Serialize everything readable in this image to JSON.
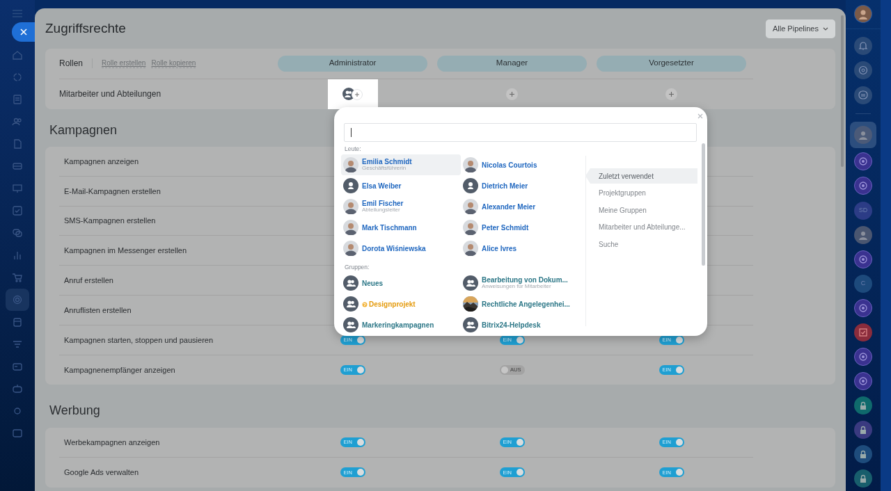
{
  "page": {
    "title": "Zugriffsrechte",
    "pipeline_filter": "Alle Pipelines"
  },
  "roles": {
    "label": "Rollen",
    "actions": [
      "Rolle erstellen",
      "Rolle kopieren"
    ],
    "columns": [
      {
        "name": "Administrator"
      },
      {
        "name": "Manager"
      },
      {
        "name": "Vorgesetzter"
      }
    ]
  },
  "members_row": {
    "label": "Mitarbeiter und Abteilungen",
    "cells": [
      {
        "selected": true
      },
      {
        "selected": false
      },
      {
        "selected": false
      }
    ]
  },
  "sections": [
    {
      "title": "Kampagnen",
      "rows": [
        {
          "label": "Kampagnen anzeigen"
        },
        {
          "label": "E-Mail-Kampagnen erstellen"
        },
        {
          "label": "SMS-Kampagnen erstellen"
        },
        {
          "label": "Kampagnen im Messenger erstellen"
        },
        {
          "label": "Anruf erstellen"
        },
        {
          "label": "Anruflisten erstellen"
        },
        {
          "label": "Kampagnen starten, stoppen und pausieren",
          "toggles": [
            {
              "on": true,
              "label": "EIN"
            },
            {
              "on": true,
              "label": "EIN"
            },
            {
              "on": true,
              "label": "EIN"
            }
          ]
        },
        {
          "label": "Kampagnenempfänger anzeigen",
          "toggles": [
            {
              "on": true,
              "label": "EIN"
            },
            {
              "on": false,
              "label": "AUS"
            },
            {
              "on": true,
              "label": "EIN"
            }
          ]
        }
      ]
    },
    {
      "title": "Werbung",
      "rows": [
        {
          "label": "Werbekampagnen anzeigen",
          "toggles": [
            {
              "on": true,
              "label": "EIN"
            },
            {
              "on": true,
              "label": "EIN"
            },
            {
              "on": true,
              "label": "EIN"
            }
          ]
        },
        {
          "label": "Google Ads verwalten",
          "toggles": [
            {
              "on": true,
              "label": "EIN"
            },
            {
              "on": true,
              "label": "EIN"
            },
            {
              "on": true,
              "label": "EIN"
            }
          ]
        }
      ]
    }
  ],
  "selector_popup": {
    "people_heading": "Leute:",
    "people": [
      {
        "name": "Emilia Schmidt",
        "subtitle": "Geschäftsführerin",
        "selected": true
      },
      {
        "name": "Nicolas Courtois",
        "selected": false
      },
      {
        "name": "Elsa Weiber",
        "kind": "default",
        "selected": false
      },
      {
        "name": "Dietrich Meier",
        "kind": "default",
        "selected": false
      },
      {
        "name": "Emil Fischer",
        "subtitle": "Abteilungsleiter",
        "selected": false
      },
      {
        "name": "Alexander Meier",
        "selected": false
      },
      {
        "name": "Mark Tischmann",
        "selected": false
      },
      {
        "name": "Peter Schmidt",
        "selected": false
      },
      {
        "name": "Dorota Wiśniewska",
        "selected": false
      },
      {
        "name": "Alice Ivres",
        "selected": false
      }
    ],
    "groups_heading": "Gruppen:",
    "groups": [
      {
        "name": "Neues",
        "kind": "group",
        "extranet": false
      },
      {
        "name": "Bearbeitung von Dokum...",
        "subtitle": "Anweisungen für Mitarbeiter",
        "kind": "group",
        "extranet": false
      },
      {
        "name": "Designprojekt",
        "kind": "group",
        "extranet": true
      },
      {
        "name": "Rechtliche Angelegenhei...",
        "kind": "picture",
        "extranet": false
      },
      {
        "name": "Markeringkampagnen",
        "kind": "group",
        "extranet": false
      },
      {
        "name": "Bitrix24-Helpdesk",
        "kind": "group",
        "extranet": false
      }
    ],
    "tabs": [
      {
        "label": "Zuletzt verwendet",
        "selected": true
      },
      {
        "label": "Projektgruppen",
        "selected": false
      },
      {
        "label": "Meine Gruppen",
        "selected": false
      },
      {
        "label": "Mitarbeiter und Abteilunge...",
        "selected": false
      },
      {
        "label": "Suche",
        "selected": false
      }
    ]
  },
  "right_sidebar": {
    "chats": [
      {
        "kind": "avatar",
        "color": "#4b5a78",
        "selected": true
      },
      {
        "kind": "logo",
        "color": "#3a3290"
      },
      {
        "kind": "logo",
        "color": "#3a3290"
      },
      {
        "kind": "initials",
        "text": "SD",
        "color": "#2c3c86"
      },
      {
        "kind": "avatar",
        "color": "#4a5670"
      },
      {
        "kind": "logo",
        "color": "#3a3290"
      },
      {
        "kind": "initials",
        "text": "C",
        "color": "#1d4a7c"
      },
      {
        "kind": "logo",
        "color": "#3a3290"
      },
      {
        "kind": "task",
        "color": "#8a2c3c"
      },
      {
        "kind": "logo",
        "color": "#3a3290"
      },
      {
        "kind": "logo",
        "color": "#3a3290"
      },
      {
        "kind": "lock",
        "color": "#0f6a6c"
      },
      {
        "kind": "lock",
        "color": "#3a3a80"
      },
      {
        "kind": "lock",
        "color": "#1e4c7c"
      },
      {
        "kind": "lock",
        "color": "#185e6c"
      }
    ]
  }
}
